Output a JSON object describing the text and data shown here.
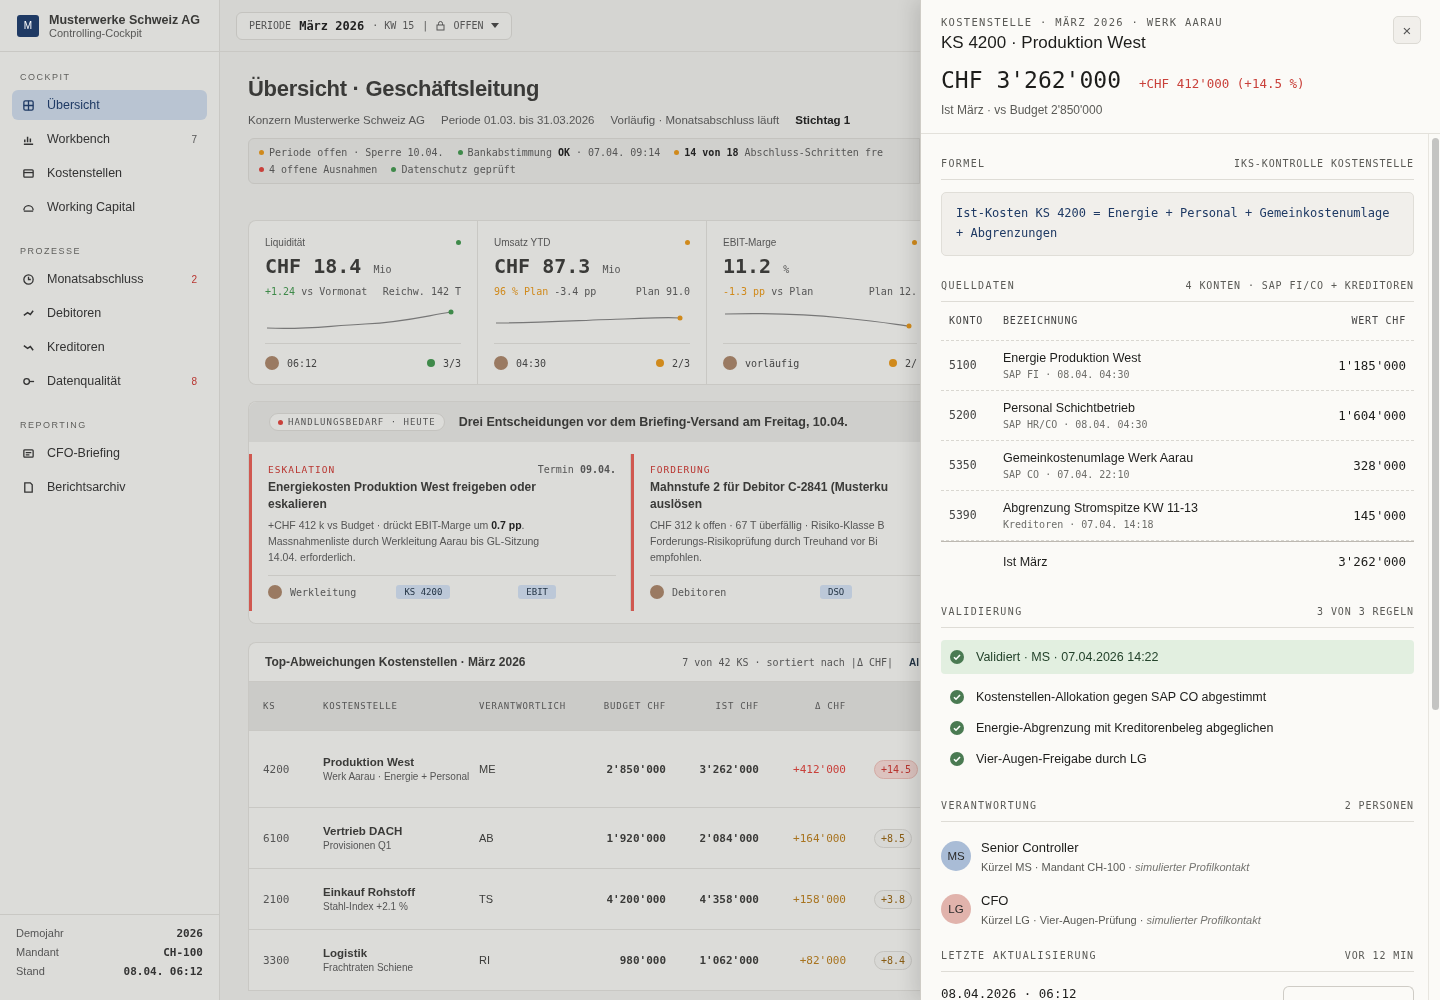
{
  "sidebar": {
    "logo": "M",
    "company": "Musterwerke Schweiz AG",
    "subtitle": "Controlling-Cockpit",
    "sections": [
      {
        "title": "COCKPIT",
        "items": [
          {
            "label": "Übersicht",
            "selected": true
          },
          {
            "label": "Workbench",
            "badge": "7",
            "alert": false,
            "selected": false
          },
          {
            "label": "Kostenstellen",
            "selected": false
          },
          {
            "label": "Working Capital",
            "selected": false
          }
        ]
      },
      {
        "title": "PROZESSE",
        "items": [
          {
            "label": "Monatsabschluss",
            "badge": "2",
            "alert": true,
            "selected": false
          },
          {
            "label": "Debitoren",
            "selected": false
          },
          {
            "label": "Kreditoren",
            "selected": false
          },
          {
            "label": "Datenqualität",
            "badge": "8",
            "alert": true,
            "selected": false
          }
        ]
      },
      {
        "title": "REPORTING",
        "items": [
          {
            "label": "CFO-Briefing",
            "selected": false
          },
          {
            "label": "Berichtsarchiv",
            "selected": false
          }
        ]
      }
    ],
    "footer": [
      {
        "label": "Demojahr",
        "value": "2026"
      },
      {
        "label": "Mandant",
        "value": "CH-100"
      },
      {
        "label": "Stand",
        "value": "08.04. 06:12"
      }
    ]
  },
  "topbar": {
    "period_label": "PERIODE",
    "period": "März 2026",
    "week": "· KW 15",
    "separator": "|",
    "status": "OFFEN"
  },
  "page": {
    "title": "Übersicht · Geschäftsleitung",
    "meta": [
      {
        "text": "Konzern Musterwerke Schweiz AG",
        "strong": false
      },
      {
        "text": "Periode 01.03. bis 31.03.2026",
        "strong": false
      },
      {
        "text": "Vorläufig · Monatsabschluss läuft",
        "strong": false
      },
      {
        "text": "Stichtag 1",
        "strong": true
      }
    ],
    "status": [
      {
        "text": "Periode offen · Sperre 10.04.",
        "color": "#d08a1c"
      },
      {
        "text": "Bankabstimmung **OK** · 07.04. 09:14",
        "color": "#3f8a4a"
      },
      {
        "text": "**14 von 18** Abschluss-Schritten fre",
        "color": "#d08a1c"
      },
      {
        "text": "4 offene Ausnahmen",
        "color": "#c9403a"
      },
      {
        "text": "Datenschutz geprüft",
        "color": "#3f8a4a"
      }
    ]
  },
  "kpis": [
    {
      "label": "Liquidität",
      "color": "#3f8a4a",
      "value": "CHF 18.4",
      "unit": "Mio",
      "delta": "+1.24",
      "note": "vs Vormonat",
      "aside": "Reichw. 142 T",
      "time": "06:12",
      "checks": "3/3"
    },
    {
      "label": "Umsatz YTD",
      "color": "#d08a1c",
      "value": "CHF 87.3",
      "unit": "Mio",
      "delta": "96 % Plan",
      "note": "-3.4 pp",
      "aside": "Plan 91.0",
      "time": "04:30",
      "checks": "2/3"
    },
    {
      "label": "EBIT-Marge",
      "color": "#d08a1c",
      "value": "11.2",
      "unit": "%",
      "delta": "-1.3 pp",
      "note": "vs Plan",
      "aside": "Plan 12.",
      "time": "vorläufig",
      "checks": "2/"
    }
  ],
  "actions": {
    "pill": "HANDLUNGSBEDARF · HEUTE",
    "headline": "Drei Entscheidungen vor dem Briefing-Versand am Freitag, 10.04.",
    "cards": [
      {
        "kind": "ESKALATION",
        "due": "Termin **09.04.**",
        "title": [
          "Energiekosten Produktion West freigeben oder",
          "eskalieren"
        ],
        "body": [
          "+CHF 412 k vs Budget · drückt EBIT-Marge um **0.7 pp**.",
          "Massnahmenliste durch Werkleitung Aarau bis GL-Sitzung",
          "14.04. erforderlich."
        ],
        "owner": "Werkleitung",
        "tags": [
          "KS 4200",
          "EBIT"
        ]
      },
      {
        "kind": "FORDERUNG",
        "title": [
          "Mahnstufe 2 für Debitor C-2841 (Musterku",
          "auslösen"
        ],
        "body": [
          "CHF 312 k offen · 67 T überfällig · Risiko-Klasse B",
          "Forderungs-Risikoprüfung durch Treuhand vor Bi",
          "empfohlen."
        ],
        "owner": "Debitoren",
        "tags": [
          "DSO"
        ]
      }
    ]
  },
  "table": {
    "title": "Top-Abweichungen Kostenstellen · März 2026",
    "info": "7 von 42 KS · sortiert nach |Δ CHF|",
    "link": "Al",
    "columns": [
      "KS",
      "KOSTENSTELLE",
      "VERANTWORTLICH",
      "BUDGET CHF",
      "IST CHF",
      "Δ CHF"
    ],
    "rows": [
      {
        "ks": "4200",
        "name": "Produktion West",
        "sub": "Werk Aarau · Energie + Personal",
        "owner": "ME",
        "budget": "2'850'000",
        "ist": "3'262'000",
        "delta": "+412'000",
        "color": "#c9403a",
        "pct": "+14.5"
      },
      {
        "ks": "6100",
        "name": "Vertrieb DACH",
        "sub": "Provisionen Q1",
        "owner": "AB",
        "budget": "1'920'000",
        "ist": "2'084'000",
        "delta": "+164'000",
        "color": "#a87420",
        "pct": "+8.5"
      },
      {
        "ks": "2100",
        "name": "Einkauf Rohstoff",
        "sub": "Stahl-Index +2.1 %",
        "owner": "TS",
        "budget": "4'200'000",
        "ist": "4'358'000",
        "delta": "+158'000",
        "color": "#a87420",
        "pct": "+3.8"
      },
      {
        "ks": "3300",
        "name": "Logistik",
        "sub": "Frachtraten Schiene",
        "owner": "RI",
        "budget": "980'000",
        "ist": "1'062'000",
        "delta": "+82'000",
        "color": "#a87420",
        "pct": "+8.4"
      }
    ]
  },
  "panel": {
    "eyebrow": "KOSTENSTELLE · MÄRZ 2026 · WERK AARAU",
    "title": "KS 4200 · Produktion West",
    "close": "×",
    "amount": "CHF 3'262'000",
    "delta": "+CHF 412'000 (+14.5 %)",
    "sub": "Ist März · vs Budget 2'850'000",
    "formula": {
      "heading": "FORMEL",
      "aside": "IKS-KONTROLLE KOSTENSTELLE",
      "text": "Ist-Kosten KS 4200 = Energie + Personal + Gemeinkostenumlage + Abgrenzungen"
    },
    "sources": {
      "heading": "QUELLDATEN",
      "aside": "4 KONTEN · SAP FI/CO + KREDITOREN",
      "columns": [
        "KONTO",
        "BEZEICHNUNG",
        "WERT CHF"
      ],
      "rows": [
        {
          "account": "5100",
          "name": "Energie Produktion West",
          "source": "SAP FI · 08.04. 04:30",
          "value": "1'185'000"
        },
        {
          "account": "5200",
          "name": "Personal Schichtbetrieb",
          "source": "SAP HR/CO · 08.04. 04:30",
          "value": "1'604'000"
        },
        {
          "account": "5350",
          "name": "Gemeinkostenumlage Werk Aarau",
          "source": "SAP CO · 07.04. 22:10",
          "value": "328'000"
        },
        {
          "account": "5390",
          "name": "Abgrenzung Stromspitze KW 11-13",
          "source": "Kreditoren · 07.04. 14:18",
          "value": "145'000"
        }
      ],
      "total_label": "Ist März",
      "total": "3'262'000"
    },
    "validation": {
      "heading": "VALIDIERUNG",
      "aside": "3 VON 3 REGELN",
      "banner": "Validiert · MS · 07.04.2026 14:22",
      "rules": [
        {
          "text": "Kostenstellen-Allokation gegen SAP CO abgestimmt",
          "passed": true
        },
        {
          "text": "Energie-Abgrenzung mit Kreditorenbeleg abgeglichen",
          "passed": true
        },
        {
          "text": "Vier-Augen-Freigabe durch LG",
          "passed": true
        }
      ]
    },
    "people": {
      "heading": "VERANTWORTUNG",
      "aside": "2 PERSONEN",
      "items": [
        {
          "initials": "MS",
          "color": "#a9bcd6",
          "role": "Senior Controller",
          "detail": "Kürzel MS · Mandant CH-100 · ",
          "note": "simulierter Profilkontakt"
        },
        {
          "initials": "LG",
          "color": "#e1b3ac",
          "role": "CFO",
          "detail": "Kürzel LG · Vier-Augen-Prüfung · ",
          "note": "simulierter Profilkontakt"
        }
      ]
    },
    "update": {
      "heading": "LETZTE AKTUALISIERUNG",
      "aside": "VOR 12 MIN",
      "stamp": "08.04.2026 · 06:12"
    }
  }
}
